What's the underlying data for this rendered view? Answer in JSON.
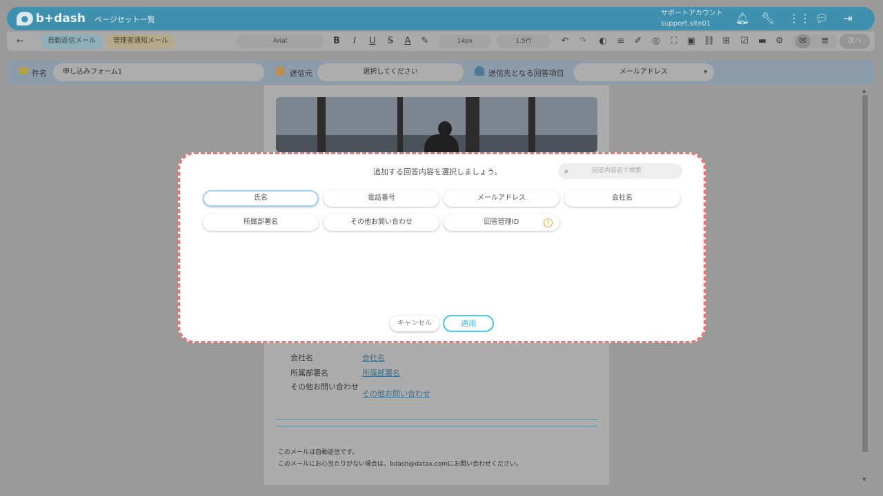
{
  "header": {
    "logo_text": "b+dash",
    "nav_title": "ページセット一覧",
    "account_label": "サポートアカウント",
    "account_id": "support.site01"
  },
  "toolbar": {
    "tab_auto": "自動返信メール",
    "tab_admin": "管理者通知メール",
    "font": "Arial",
    "size": "14px",
    "line_height": "1.5行",
    "next": "次へ"
  },
  "row2": {
    "subject_label": "件名",
    "subject_value": "申し込みフォーム1",
    "sender_label": "送信元",
    "sender_value": "選択してください",
    "recipient_label": "送信先となる回答項目",
    "recipient_value": "メールアドレス"
  },
  "content": {
    "fields": [
      {
        "label": "会社名",
        "value": "会社名"
      },
      {
        "label": "所属部署名",
        "value": "所属部署名"
      },
      {
        "label": "その他お問い合わせ",
        "value": "その他お問い合わせ"
      }
    ],
    "footer_line1": "このメールは自動返信です。",
    "footer_line2": "このメールにお心当たりがない場合は、bdash@datax.comにお問い合わせください。"
  },
  "modal": {
    "title": "追加する回答内容を選択しましょう。",
    "search_placeholder": "回答内容名で検索",
    "chips": [
      "氏名",
      "電話番号",
      "メールアドレス",
      "会社名",
      "所属部署名",
      "その他お問い合わせ",
      "回答管理ID"
    ],
    "help_mark": "?",
    "cancel": "キャンセル",
    "apply": "適用"
  }
}
